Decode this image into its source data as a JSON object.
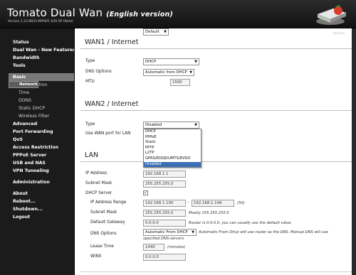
{
  "header": {
    "title": "Tomato Dual Wan",
    "subtitle": "(English version)",
    "version": "Version 1.23.8833 MIPSR1 K26 AP (Beta)"
  },
  "sidebar": {
    "items": [
      {
        "label": "Status"
      },
      {
        "label": "Dual Wan - New Features"
      },
      {
        "label": "Bandwidth"
      },
      {
        "label": "Tools"
      },
      {
        "label": "Basic"
      },
      {
        "label": "Network"
      },
      {
        "label": "Identification"
      },
      {
        "label": "Time"
      },
      {
        "label": "DDNS"
      },
      {
        "label": "Static DHCP"
      },
      {
        "label": "Wireless Filter"
      },
      {
        "label": "Advanced"
      },
      {
        "label": "Port Forwarding"
      },
      {
        "label": "QoS"
      },
      {
        "label": "Access Restriction"
      },
      {
        "label": "PPPoE Server"
      },
      {
        "label": "USB and NAS"
      },
      {
        "label": "VPN Tunneling"
      },
      {
        "label": "Administration"
      },
      {
        "label": "About"
      },
      {
        "label": "Reboot..."
      },
      {
        "label": "Shutdown..."
      },
      {
        "label": "Logout"
      }
    ]
  },
  "content": {
    "tag": "tomato",
    "wan1": {
      "title": "WAN1 / Internet",
      "type_label": "Type",
      "type_value": "DHCP",
      "dns_label": "DNS Options",
      "dns_value": "Automatic from DHCP",
      "mtu_label": "MTU",
      "mtu_mode": "Default",
      "mtu_value": "1500"
    },
    "wan2": {
      "title": "WAN2 / Internet",
      "type_label": "Type",
      "type_value": "Disabled",
      "use_port_label": "Use WAN port for LAN",
      "dropdown_options": [
        "DHCP",
        "PPPoE",
        "Static",
        "PPTP",
        "L2TP",
        "GPRS/EDGE/UMTS/EVDO",
        "Disabled"
      ],
      "highlighted_index": 6
    },
    "lan": {
      "title": "LAN",
      "ip_label": "IP Address",
      "ip_value": "192.168.1.1",
      "mask_label": "Subnet Mask",
      "mask_value": "255.255.255.0",
      "dhcp_label": "DHCP Server",
      "dhcp_checked": "✓",
      "range_label": "IP Address Range",
      "range_start": "192.168.1.100",
      "range_sep": "-",
      "range_end": "192.168.1.149",
      "range_count": "(50)",
      "sub_mask_label": "Subnet Mask",
      "sub_mask_value": "255.255.255.0",
      "sub_mask_note": "Mostly 255.255.255.0",
      "gateway_label": "Default Gateway",
      "gateway_value": "0.0.0.0",
      "gateway_note": "Router is 0.0.0.0, you can usually use the default value",
      "dns_label": "DNS Options",
      "dns_value": "Automatic From DHCP",
      "dns_note_1": "Automatic From Dhcp will use router as the DNS. Manual DNS will use",
      "dns_note_2": "specified DNS-servers",
      "lease_label": "Lease Time",
      "lease_value": "1440",
      "lease_unit": "(minutes)",
      "wins_label": "WINS",
      "wins_value": "0.0.0.0"
    }
  }
}
